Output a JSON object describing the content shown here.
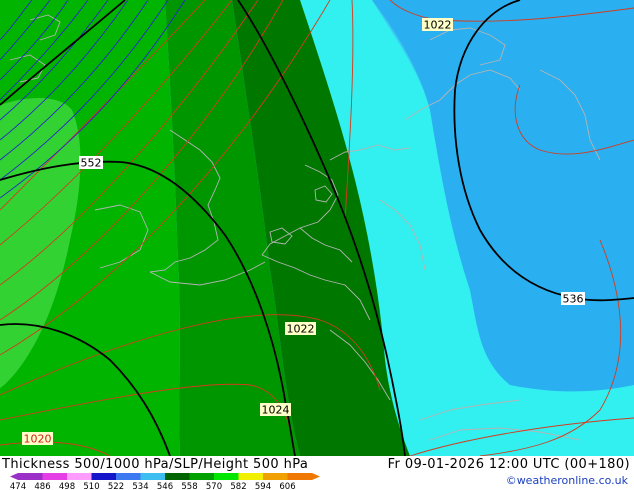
{
  "footer": {
    "title": "Thickness 500/1000 hPa/SLP/Height 500 hPa",
    "valid_time": "Fr 09-01-2026 12:00 UTC (00+180)",
    "credit": "©weatheronline.co.uk"
  },
  "legend": {
    "ticks": [
      "474",
      "486",
      "498",
      "510",
      "522",
      "534",
      "546",
      "558",
      "570",
      "582",
      "594",
      "606"
    ],
    "colors": [
      "#9b30c8",
      "#e63ee6",
      "#ff9cff",
      "#1414c8",
      "#3c78f0",
      "#3cbef0",
      "#006400",
      "#00a000",
      "#00e600",
      "#f0f000",
      "#f0a000",
      "#f07800"
    ]
  },
  "map": {
    "fill_colors": {
      "light_green": "#32d232",
      "green": "#00b400",
      "mid_green": "#009600",
      "dark_green": "#007800",
      "cyan": "#32f0f0",
      "light_blue": "#3cc8f0",
      "blue": "#2ab0f0"
    },
    "contour_labels": {
      "height_552": "552",
      "height_536": "536",
      "slp_1022_top": "1022",
      "slp_1022_mid": "1022",
      "slp_1024": "1024",
      "slp_1020": "1020"
    }
  }
}
